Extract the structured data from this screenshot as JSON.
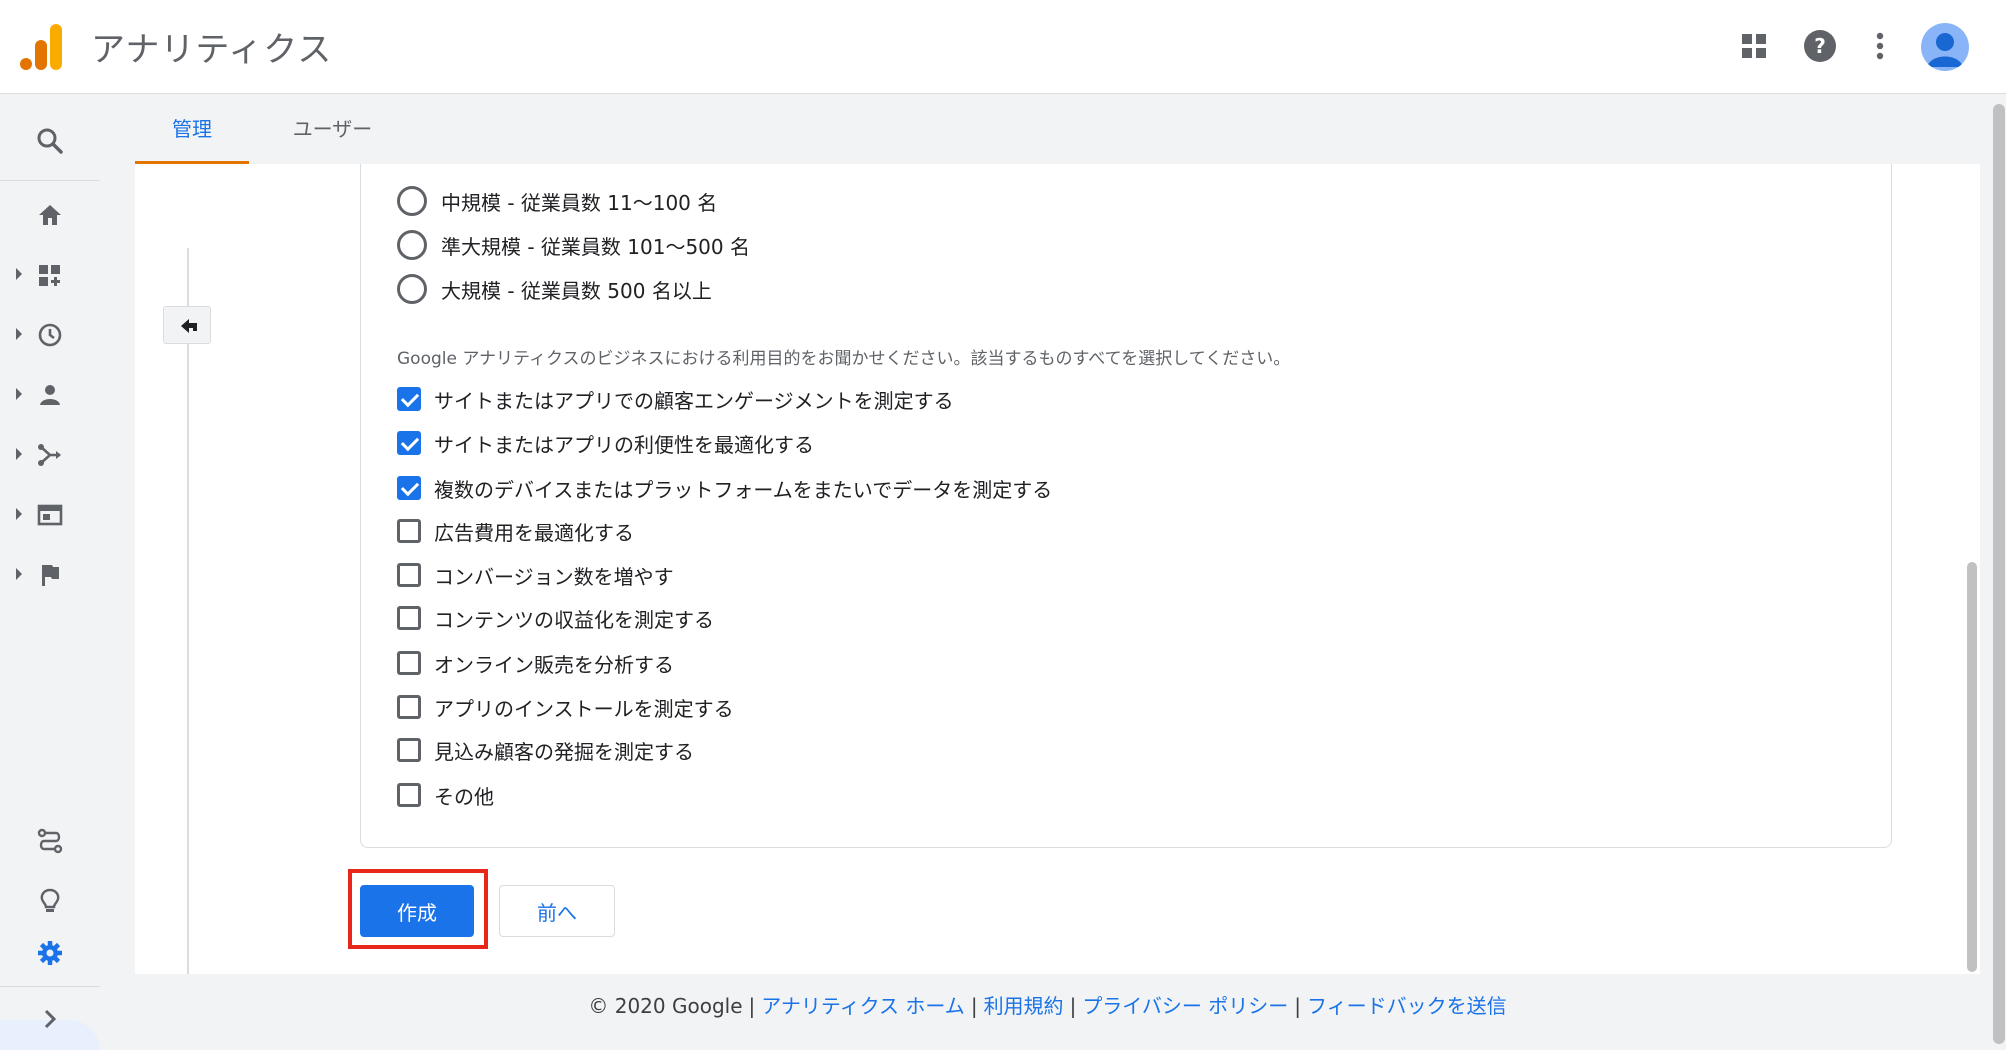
{
  "header": {
    "title": "アナリティクス"
  },
  "tabs": [
    {
      "label": "管理"
    },
    {
      "label": "ユーザー"
    }
  ],
  "radios": [
    {
      "label": "中規模 - 従業員数 11〜100 名",
      "selected": false
    },
    {
      "label": "準大規模 - 従業員数 101〜500 名",
      "selected": false
    },
    {
      "label": "大規模 - 従業員数 500 名以上",
      "selected": false
    }
  ],
  "question": "Google アナリティクスのビジネスにおける利用目的をお聞かせください。該当するものすべてを選択してください。",
  "checkboxes": [
    {
      "label": "サイトまたはアプリでの顧客エンゲージメントを測定する",
      "checked": true
    },
    {
      "label": "サイトまたはアプリの利便性を最適化する",
      "checked": true
    },
    {
      "label": "複数のデバイスまたはプラットフォームをまたいでデータを測定する",
      "checked": true
    },
    {
      "label": "広告費用を最適化する",
      "checked": false
    },
    {
      "label": "コンバージョン数を増やす",
      "checked": false
    },
    {
      "label": "コンテンツの収益化を測定する",
      "checked": false
    },
    {
      "label": "オンライン販売を分析する",
      "checked": false
    },
    {
      "label": "アプリのインストールを測定する",
      "checked": false
    },
    {
      "label": "見込み顧客の発掘を測定する",
      "checked": false
    },
    {
      "label": "その他",
      "checked": false
    }
  ],
  "buttons": {
    "create": "作成",
    "previous": "前へ"
  },
  "footer": {
    "copyright": "© 2020 Google",
    "links": [
      "アナリティクス ホーム",
      "利用規約",
      "プライバシー ポリシー",
      "フィードバックを送信"
    ]
  },
  "colors": {
    "accent": "#1a73e8",
    "tab_underline": "#e37400",
    "highlight": "#e8271b",
    "logo_dark": "#e37400",
    "logo_light": "#f9ab00"
  }
}
